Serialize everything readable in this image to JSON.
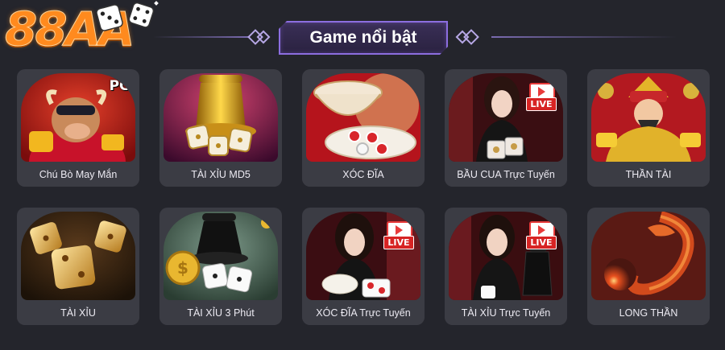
{
  "brand": {
    "logo_text": "88AA"
  },
  "section": {
    "title": "Game nổi bật"
  },
  "colors": {
    "accent": "#8c6ee0",
    "background": "#24252c",
    "card": "#3b3c44",
    "logo": "#ff8a1e",
    "live_badge": "#d72424"
  },
  "games": [
    {
      "label": "Chú Bò May Mắn",
      "badge": "PG",
      "icon": "lucky-ox-icon"
    },
    {
      "label": "TÀI XỈU MD5",
      "badge": "",
      "icon": "golden-dice-cup-icon"
    },
    {
      "label": "XÓC ĐĨA",
      "badge": "",
      "icon": "xoc-dia-bowl-icon"
    },
    {
      "label": "BẦU CUA Trực Tuyến",
      "badge": "LIVE",
      "icon": "live-dealer-icon"
    },
    {
      "label": "THẦN TÀI",
      "badge": "",
      "icon": "god-of-wealth-icon"
    },
    {
      "label": "TÀI XỈU",
      "badge": "",
      "icon": "golden-dice-icon"
    },
    {
      "label": "TÀI XỈU 3 Phút",
      "badge": "",
      "icon": "dice-cup-coin-icon"
    },
    {
      "label": "XÓC ĐĨA Trực Tuyến",
      "badge": "LIVE",
      "icon": "live-dealer-icon"
    },
    {
      "label": "TÀI XỈU Trực Tuyến",
      "badge": "LIVE",
      "icon": "live-dealer-icon"
    },
    {
      "label": "LONG THẦN",
      "badge": "",
      "icon": "dragon-icon"
    }
  ]
}
